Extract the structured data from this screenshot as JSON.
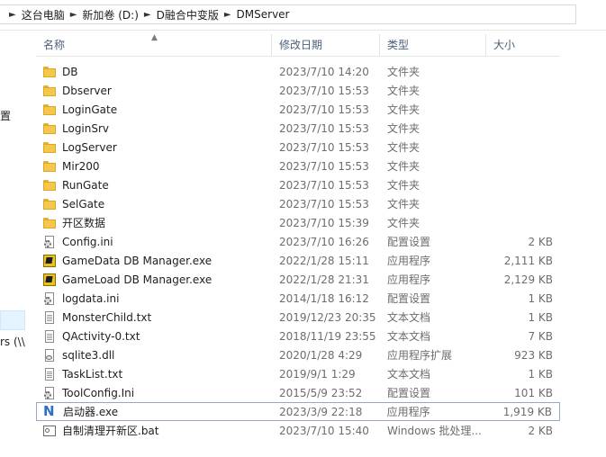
{
  "breadcrumb": {
    "items": [
      "这台电脑",
      "新加卷 (D:)",
      "D融合中变版",
      "DMServer"
    ]
  },
  "leftpane": {
    "clip1": "置",
    "clip2": "rs (\\\\"
  },
  "columns": {
    "name": "名称",
    "date": "修改日期",
    "type": "类型",
    "size": "大小"
  },
  "files": [
    {
      "name": "DB",
      "date": "2023/7/10 14:20",
      "type": "文件夹",
      "size": "",
      "icon": "folder-icon"
    },
    {
      "name": "Dbserver",
      "date": "2023/7/10 15:53",
      "type": "文件夹",
      "size": "",
      "icon": "folder-icon"
    },
    {
      "name": "LoginGate",
      "date": "2023/7/10 15:53",
      "type": "文件夹",
      "size": "",
      "icon": "folder-icon"
    },
    {
      "name": "LoginSrv",
      "date": "2023/7/10 15:53",
      "type": "文件夹",
      "size": "",
      "icon": "folder-icon"
    },
    {
      "name": "LogServer",
      "date": "2023/7/10 15:53",
      "type": "文件夹",
      "size": "",
      "icon": "folder-icon"
    },
    {
      "name": "Mir200",
      "date": "2023/7/10 15:53",
      "type": "文件夹",
      "size": "",
      "icon": "folder-icon"
    },
    {
      "name": "RunGate",
      "date": "2023/7/10 15:53",
      "type": "文件夹",
      "size": "",
      "icon": "folder-icon"
    },
    {
      "name": "SelGate",
      "date": "2023/7/10 15:53",
      "type": "文件夹",
      "size": "",
      "icon": "folder-icon"
    },
    {
      "name": "开区数据",
      "date": "2023/7/10 15:39",
      "type": "文件夹",
      "size": "",
      "icon": "folder-icon"
    },
    {
      "name": "Config.ini",
      "date": "2023/7/10 16:26",
      "type": "配置设置",
      "size": "2 KB",
      "icon": "config-file-icon"
    },
    {
      "name": "GameData DB Manager.exe",
      "date": "2022/1/28 15:11",
      "type": "应用程序",
      "size": "2,111 KB",
      "icon": "exe-icon"
    },
    {
      "name": "GameLoad DB Manager.exe",
      "date": "2022/1/28 21:31",
      "type": "应用程序",
      "size": "2,129 KB",
      "icon": "exe-icon"
    },
    {
      "name": "logdata.ini",
      "date": "2014/1/18 16:12",
      "type": "配置设置",
      "size": "1 KB",
      "icon": "config-file-icon"
    },
    {
      "name": "MonsterChild.txt",
      "date": "2019/12/23 20:35",
      "type": "文本文档",
      "size": "1 KB",
      "icon": "text-file-icon"
    },
    {
      "name": "QActivity-0.txt",
      "date": "2018/11/19 23:55",
      "type": "文本文档",
      "size": "7 KB",
      "icon": "text-file-icon"
    },
    {
      "name": "sqlite3.dll",
      "date": "2020/1/28 4:29",
      "type": "应用程序扩展",
      "size": "923 KB",
      "icon": "dll-file-icon"
    },
    {
      "name": "TaskList.txt",
      "date": "2019/9/1 1:29",
      "type": "文本文档",
      "size": "1 KB",
      "icon": "text-file-icon"
    },
    {
      "name": "ToolConfig.Ini",
      "date": "2015/5/9 23:52",
      "type": "配置设置",
      "size": "101 KB",
      "icon": "config-file-icon"
    },
    {
      "name": "启动器.exe",
      "date": "2023/3/9 22:18",
      "type": "应用程序",
      "size": "1,919 KB",
      "icon": "launcher-icon"
    },
    {
      "name": "自制清理开新区.bat",
      "date": "2023/7/10 15:40",
      "type": "Windows 批处理...",
      "size": "2 KB",
      "icon": "batch-file-icon"
    }
  ]
}
